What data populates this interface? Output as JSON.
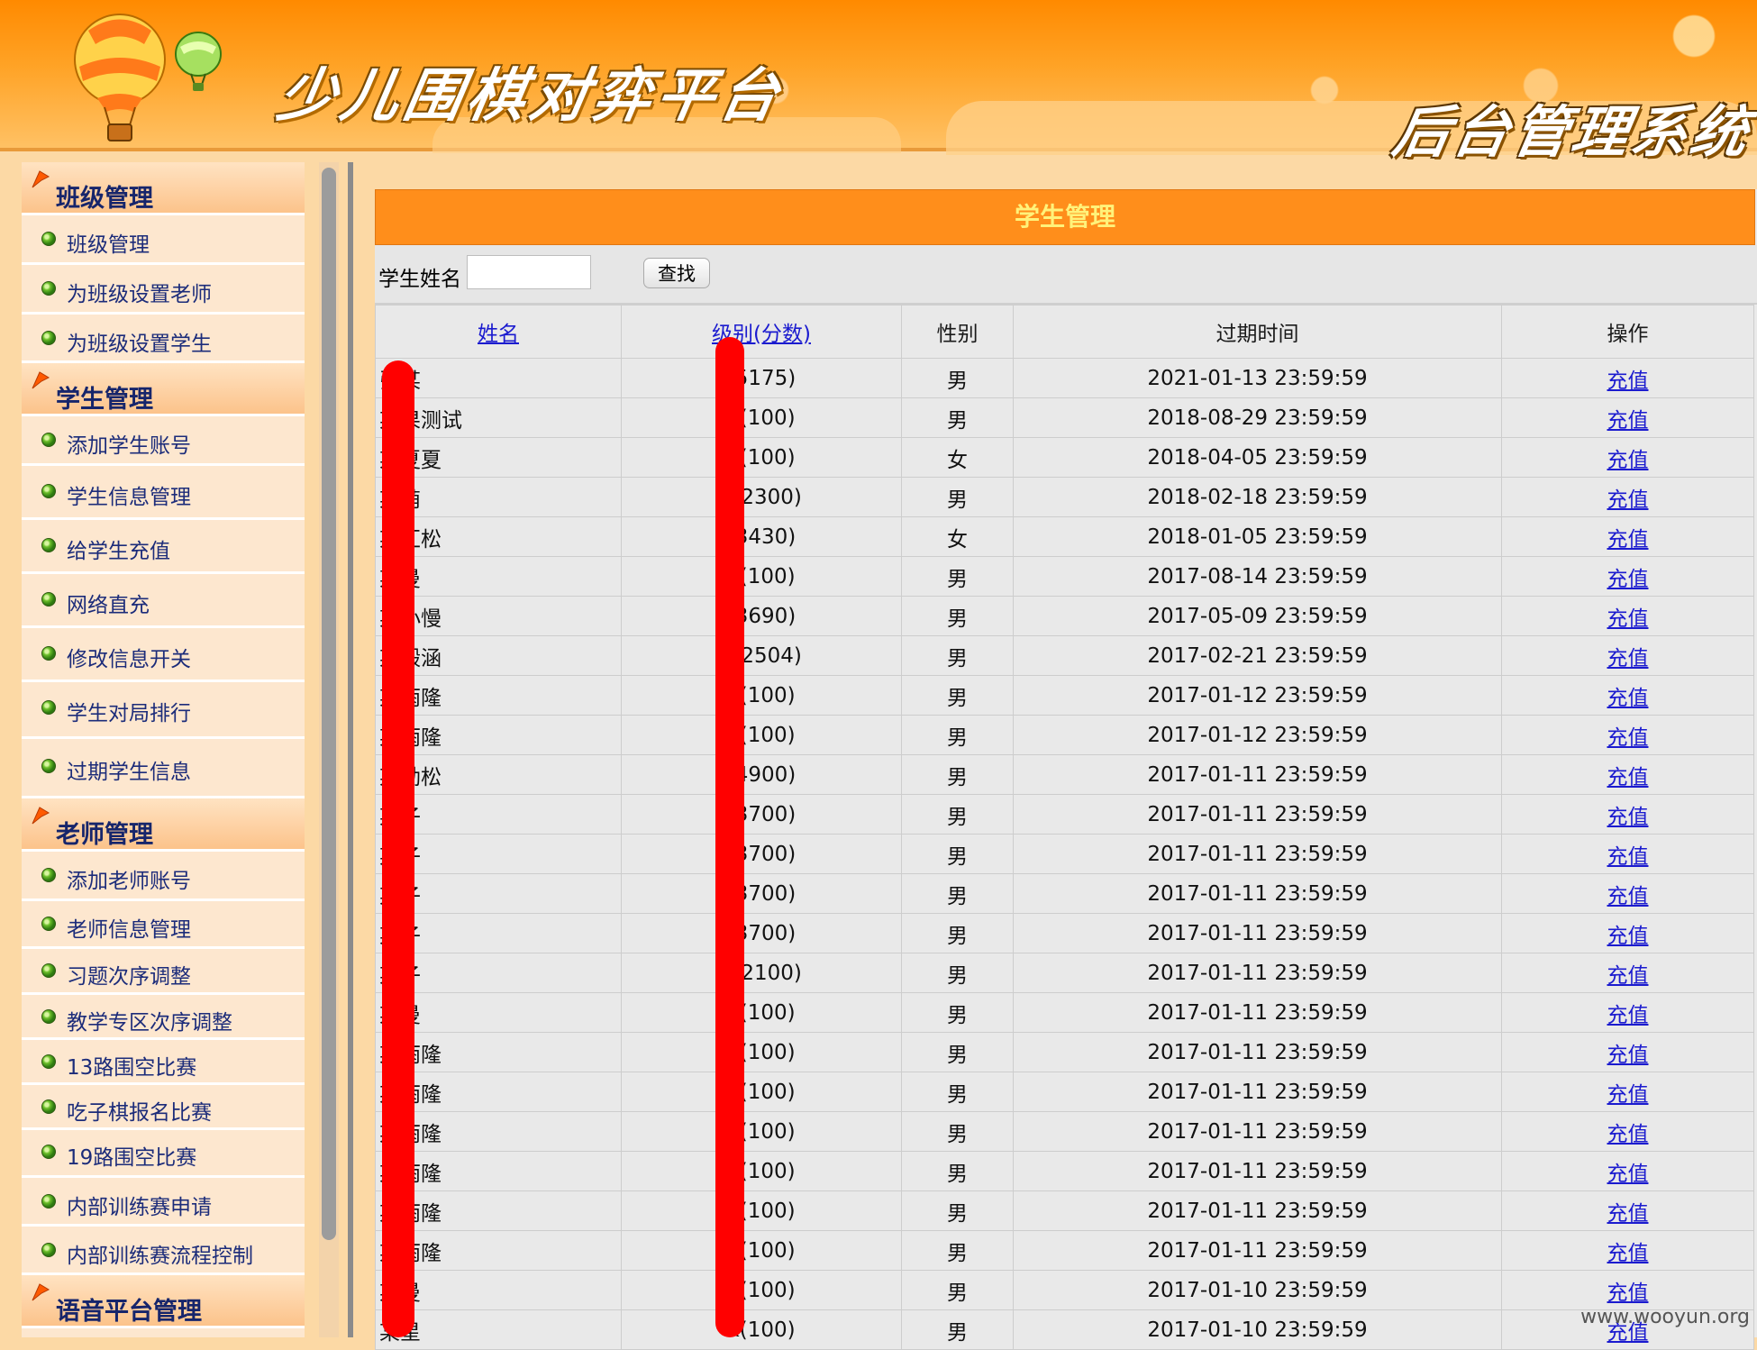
{
  "header": {
    "app_title": "少儿围棋对弈平台",
    "sub_title": "后台管理系统"
  },
  "sidebar": {
    "sections": [
      {
        "title": "班级管理",
        "items": [
          "班级管理",
          "为班级设置老师",
          "为班级设置学生"
        ]
      },
      {
        "title": "学生管理",
        "items": [
          "添加学生账号",
          "学生信息管理",
          "给学生充值",
          "网络直充",
          "修改信息开关",
          "学生对局排行",
          "过期学生信息"
        ]
      },
      {
        "title": "老师管理",
        "items": [
          "添加老师账号",
          "老师信息管理",
          "习题次序调整",
          "教学专区次序调整",
          "13路围空比赛",
          "吃子棋报名比赛",
          "19路围空比赛",
          "内部训练赛申请",
          "内部训练赛流程控制"
        ]
      },
      {
        "title": "语音平台管理",
        "items": []
      }
    ]
  },
  "main": {
    "title": "学生管理",
    "search_label": "学生姓名",
    "search_value": "",
    "search_button": "查找",
    "columns": [
      "姓名",
      "级别(分数)",
      "性别",
      "过期时间",
      "操作"
    ],
    "rows": [
      {
        "name": "张某",
        "level": "(5175)",
        "gender": "男",
        "expire": "2021-01-13 23:59:59",
        "action": "充值"
      },
      {
        "name": "某果测试",
        "level": "k(100)",
        "gender": "男",
        "expire": "2018-08-29 23:59:59",
        "action": "充值"
      },
      {
        "name": "某夏夏",
        "level": "k(100)",
        "gender": "女",
        "expire": "2018-04-05 23:59:59",
        "action": "充值"
      },
      {
        "name": "某萌",
        "level": "k(2300)",
        "gender": "男",
        "expire": "2018-02-18 23:59:59",
        "action": "充值"
      },
      {
        "name": "某汇松",
        "level": "(3430)",
        "gender": "女",
        "expire": "2018-01-05 23:59:59",
        "action": "充值"
      },
      {
        "name": "某曼",
        "level": "k(100)",
        "gender": "男",
        "expire": "2017-08-14 23:59:59",
        "action": "充值"
      },
      {
        "name": "某小慢",
        "level": "(3690)",
        "gender": "男",
        "expire": "2017-05-09 23:59:59",
        "action": "充值"
      },
      {
        "name": "某毅涵",
        "level": "k(2504)",
        "gender": "男",
        "expire": "2017-02-21 23:59:59",
        "action": "充值"
      },
      {
        "name": "某雨隆",
        "level": "k(100)",
        "gender": "男",
        "expire": "2017-01-12 23:59:59",
        "action": "充值"
      },
      {
        "name": "某雨隆",
        "level": "k(100)",
        "gender": "男",
        "expire": "2017-01-12 23:59:59",
        "action": "充值"
      },
      {
        "name": "某劲松",
        "level": "(4900)",
        "gender": "男",
        "expire": "2017-01-11 23:59:59",
        "action": "充值"
      },
      {
        "name": "某子",
        "level": "(3700)",
        "gender": "男",
        "expire": "2017-01-11 23:59:59",
        "action": "充值"
      },
      {
        "name": "某子",
        "level": "(3700)",
        "gender": "男",
        "expire": "2017-01-11 23:59:59",
        "action": "充值"
      },
      {
        "name": "某子",
        "level": "(3700)",
        "gender": "男",
        "expire": "2017-01-11 23:59:59",
        "action": "充值"
      },
      {
        "name": "某子",
        "level": "(3700)",
        "gender": "男",
        "expire": "2017-01-11 23:59:59",
        "action": "充值"
      },
      {
        "name": "某子",
        "level": "k(2100)",
        "gender": "男",
        "expire": "2017-01-11 23:59:59",
        "action": "充值"
      },
      {
        "name": "某曼",
        "level": "k(100)",
        "gender": "男",
        "expire": "2017-01-11 23:59:59",
        "action": "充值"
      },
      {
        "name": "某雨隆",
        "level": "k(100)",
        "gender": "男",
        "expire": "2017-01-11 23:59:59",
        "action": "充值"
      },
      {
        "name": "某雨隆",
        "level": "k(100)",
        "gender": "男",
        "expire": "2017-01-11 23:59:59",
        "action": "充值"
      },
      {
        "name": "某雨隆",
        "level": "k(100)",
        "gender": "男",
        "expire": "2017-01-11 23:59:59",
        "action": "充值"
      },
      {
        "name": "某雨隆",
        "level": "k(100)",
        "gender": "男",
        "expire": "2017-01-11 23:59:59",
        "action": "充值"
      },
      {
        "name": "某雨隆",
        "level": "k(100)",
        "gender": "男",
        "expire": "2017-01-11 23:59:59",
        "action": "充值"
      },
      {
        "name": "某雨隆",
        "level": "k(100)",
        "gender": "男",
        "expire": "2017-01-11 23:59:59",
        "action": "充值"
      },
      {
        "name": "某曼",
        "level": "k(100)",
        "gender": "男",
        "expire": "2017-01-10 23:59:59",
        "action": "充值"
      },
      {
        "name": "某星",
        "level": "k(100)",
        "gender": "男",
        "expire": "2017-01-10 23:59:59",
        "action": "充值"
      }
    ]
  },
  "watermark": "www.wooyun.org",
  "colors": {
    "header_orange": "#ff8a00",
    "panel_title_bg": "#ff8e1b",
    "panel_title_text": "#fff27a",
    "link_blue": "#1b1bcf",
    "redaction_red": "#ff0000",
    "sidebar_text": "#1c2c7a"
  },
  "icons": {
    "section": "orange-flag-icon",
    "item": "green-dot-icon",
    "logo": "hot-air-balloon-icon"
  }
}
